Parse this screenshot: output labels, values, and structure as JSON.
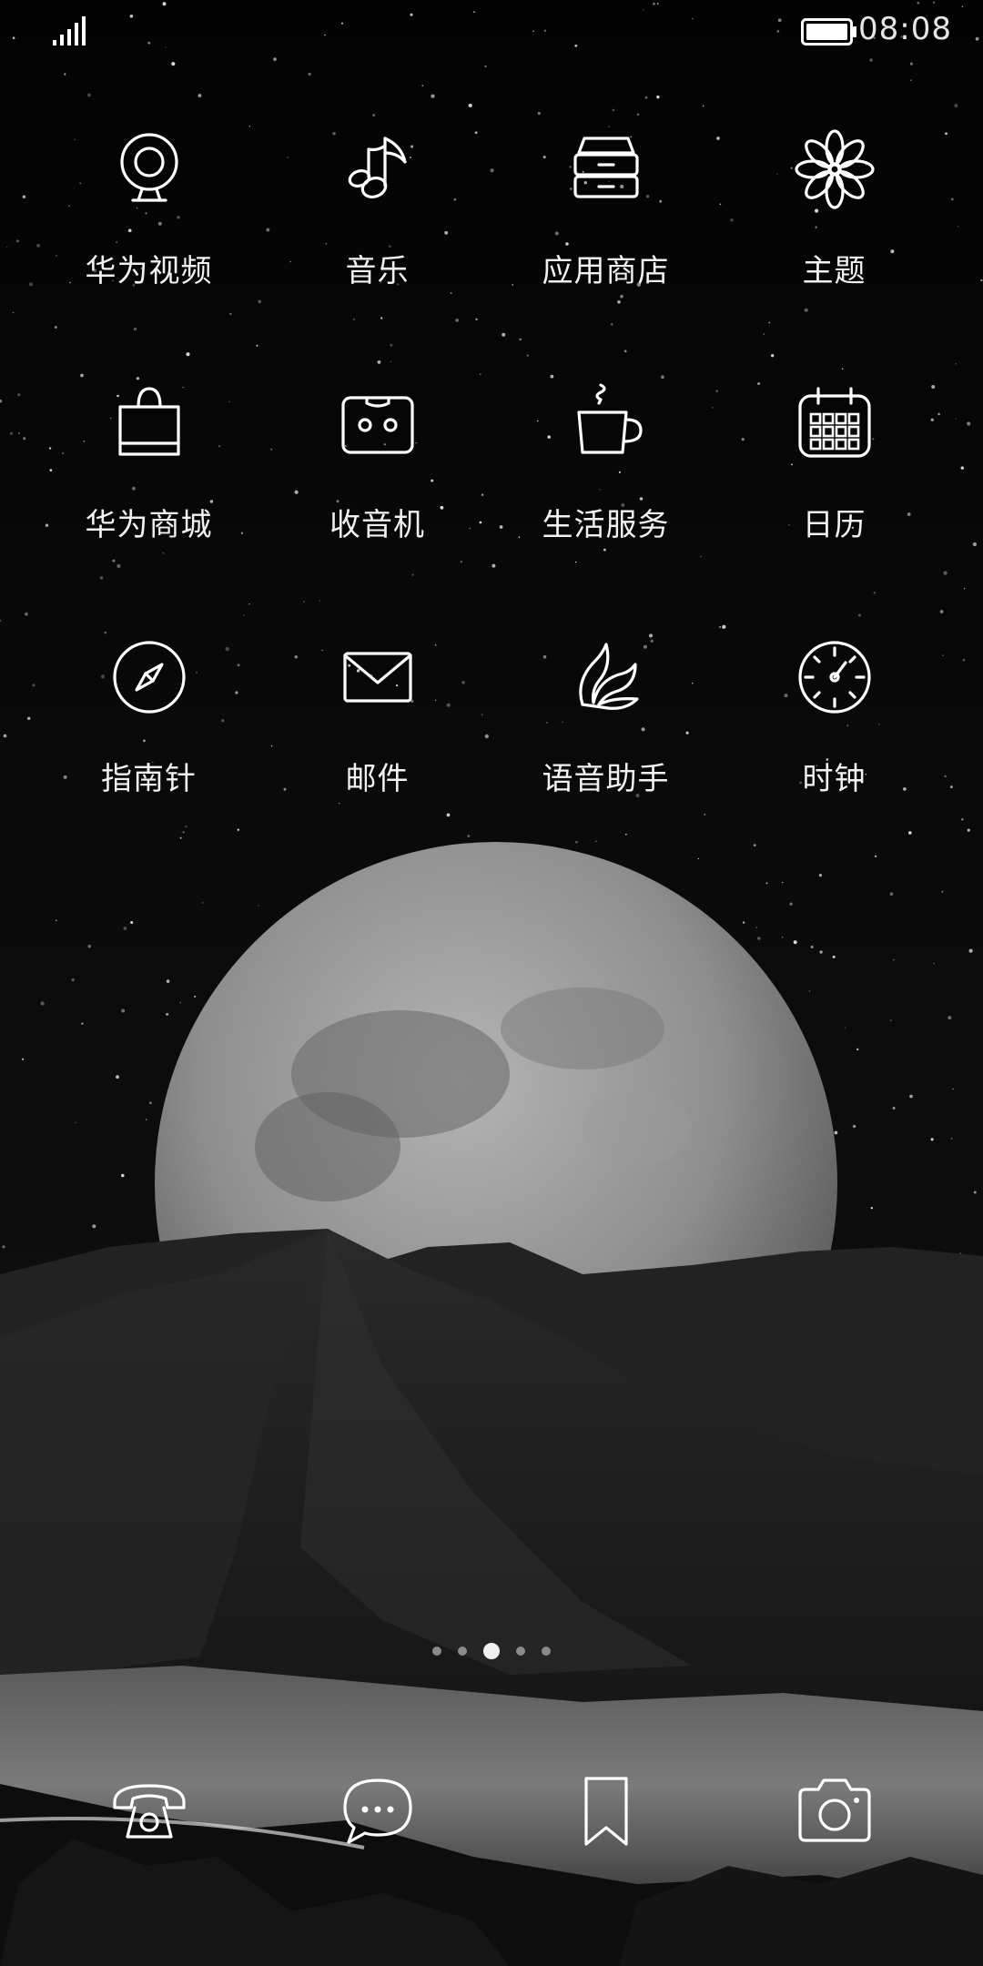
{
  "status_bar": {
    "time": "08:08",
    "signal_icon": "cellular-signal-icon",
    "battery_icon": "battery-full-icon"
  },
  "apps": [
    {
      "label": "华为视频",
      "icon": "webcam-icon"
    },
    {
      "label": "音乐",
      "icon": "music-note-icon"
    },
    {
      "label": "应用商店",
      "icon": "drawers-icon"
    },
    {
      "label": "主题",
      "icon": "flower-icon"
    },
    {
      "label": "华为商城",
      "icon": "shopping-bag-icon"
    },
    {
      "label": "收音机",
      "icon": "cassette-icon"
    },
    {
      "label": "生活服务",
      "icon": "coffee-cup-icon"
    },
    {
      "label": "日历",
      "icon": "calendar-icon"
    },
    {
      "label": "指南针",
      "icon": "compass-icon"
    },
    {
      "label": "邮件",
      "icon": "envelope-icon"
    },
    {
      "label": "语音助手",
      "icon": "leaf-icon"
    },
    {
      "label": "时钟",
      "icon": "clock-icon"
    }
  ],
  "page_indicator": {
    "total": 5,
    "current": 3
  },
  "dock": [
    {
      "name": "phone",
      "icon": "telephone-icon"
    },
    {
      "name": "messages",
      "icon": "chat-bubble-icon"
    },
    {
      "name": "bookmarks",
      "icon": "bookmark-icon"
    },
    {
      "name": "camera",
      "icon": "camera-icon"
    }
  ],
  "colors": {
    "icon": "#ffffff",
    "label": "#f2f2f2",
    "background": "#050505",
    "moon": "#8c8c8c"
  }
}
